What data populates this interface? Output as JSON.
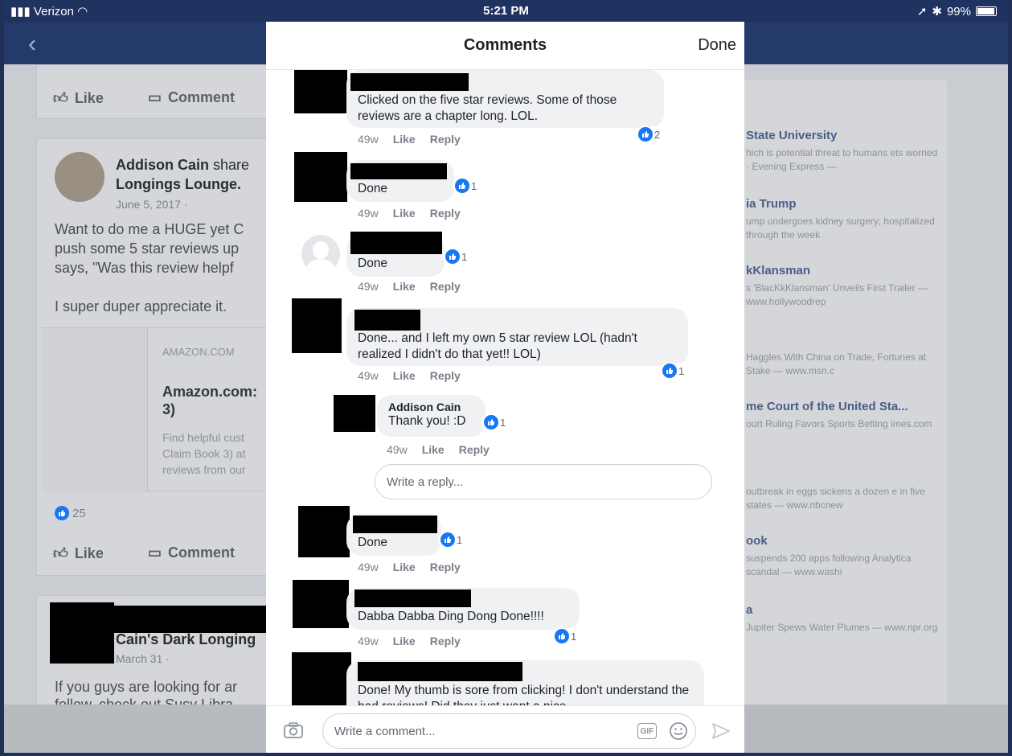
{
  "status": {
    "carrier": "Verizon",
    "time": "5:21 PM",
    "battery": "99%"
  },
  "feed": {
    "like_label": "Like",
    "comment_label": "Comment",
    "post1": {
      "author": "Addison Cain",
      "shared": "share",
      "page": "Longings Lounge.",
      "date": "June 5, 2017 ·",
      "text1": "Want to do me a HUGE yet C",
      "text2": "push some 5 star reviews up",
      "text3": "says, \"Was this review helpf",
      "text4": "I super duper appreciate it.",
      "link_domain": "AMAZON.COM",
      "link_title1": "Amazon.com:",
      "link_title2": "3)",
      "link_desc1": "Find helpful cust",
      "link_desc2": "Claim Book 3) at",
      "link_desc3": "reviews from our",
      "likes": "25"
    },
    "post2": {
      "page": "Cain's Dark Longing",
      "date": "March 31 ·",
      "text1": "If you guys are looking for ar",
      "text2": "follow, check out Susy Libra"
    }
  },
  "sidebar": {
    "items": [
      {
        "title": "State University",
        "sub": "hich is potential threat to humans ets worried · Evening Express —"
      },
      {
        "title": "ia Trump",
        "sub": "ump undergoes kidney surgery; hospitalized through the week"
      },
      {
        "title": "kKlansman",
        "sub": "s 'BlacKkKlansman' Unveils First Trailer — www.hollywoodrep"
      },
      {
        "title": "",
        "sub": "Haggles With China on Trade, Fortunes at Stake — www.msn.c"
      },
      {
        "title": "me Court of the United Sta...",
        "sub": "ourt Ruling Favors Sports Betting imes.com"
      },
      {
        "title": "",
        "sub": "outbreak in eggs sickens a dozen e in five states — www.nbcnew"
      },
      {
        "title": "ook",
        "sub": "suspends 200 apps following Analytica scandal — www.washi"
      },
      {
        "title": "a",
        "sub": "Jupiter Spews Water Plumes — www.npr.org"
      }
    ]
  },
  "modal": {
    "title": "Comments",
    "done_label": "Done",
    "like_label": "Like",
    "reply_label": "Reply",
    "comments": [
      {
        "text": "Clicked on the five star reviews. Some of those reviews are a chapter long. LOL.",
        "time": "49w",
        "reactions": "2"
      },
      {
        "text": "Done",
        "time": "49w",
        "reactions": "1"
      },
      {
        "text": "Done",
        "time": "49w",
        "reactions": "1"
      },
      {
        "text": "Done... and I left my own 5 star review LOL (hadn't realized I didn't do that yet!! LOL)",
        "time": "49w",
        "reactions": "1"
      },
      {
        "text": "Done",
        "time": "49w",
        "reactions": "1"
      },
      {
        "text": "Dabba Dabba Ding Dong Done!!!!",
        "time": "49w",
        "reactions": "1"
      },
      {
        "text": "Done! My thumb is sore from clicking! I don't understand the bad reviews! Did they just want a nice",
        "time": "",
        "reactions": ""
      }
    ],
    "reply": {
      "author": "Addison Cain",
      "text": "Thank you! :D",
      "time": "49w",
      "reactions": "1"
    },
    "reply_placeholder": "Write a reply...",
    "comment_placeholder": "Write a comment...",
    "gif_label": "GIF"
  }
}
